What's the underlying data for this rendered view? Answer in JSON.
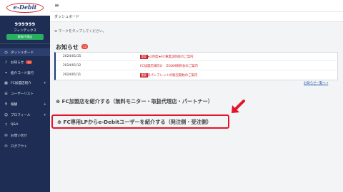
{
  "brand": {
    "logo_text": "e-Debit"
  },
  "user": {
    "id": "999999",
    "company": "フィンテックス",
    "role": "取扱代理店"
  },
  "sidebar": {
    "items": [
      {
        "label": "ダッシュボード",
        "icon": "speedometer-icon"
      },
      {
        "label": "お知らせ",
        "badge": "12",
        "icon": "bell-icon"
      },
      {
        "label": "紹介コード発行",
        "icon": "link-icon"
      },
      {
        "label": "FC加盟店紹介",
        "icon": "store-icon"
      },
      {
        "label": "ユーザーリスト",
        "icon": "list-icon"
      },
      {
        "label": "報酬",
        "icon": "yen-icon"
      },
      {
        "label": "プロフィール",
        "icon": "person-icon"
      },
      {
        "label": "Q&A",
        "icon": "question-icon"
      },
      {
        "label": "お問い合せ",
        "icon": "mail-icon"
      },
      {
        "label": "ログアウト",
        "icon": "logout-icon"
      }
    ]
  },
  "header": {
    "breadcrumb": "ダッシュボード"
  },
  "main": {
    "hint": "マークをタップしてください。",
    "news": {
      "title": "お知らせ",
      "count": "12",
      "items": [
        {
          "date": "2024/01/15",
          "tag": "重要",
          "text": "★2月度★FC事業説明会のご案内"
        },
        {
          "date": "2024/01/12",
          "tag": "",
          "text": "FC加盟店様向け　ZOOM研修会のご案内"
        },
        {
          "date": "2024/01/11",
          "tag": "重要",
          "text": "新パンフレットの販売開始のご案内"
        }
      ],
      "more": "お知らせ一覧へ→"
    },
    "intro_link_1": "FC加盟店を紹介する（無料モニター・取扱代理店・パートナー）",
    "intro_link_2": "FC専用LPからe-Debitユーザーを紹介する（発注側・受注側）"
  },
  "colors": {
    "sidebar_bg": "#1d2d54",
    "accent_red": "#e2152a",
    "badge_green": "#27ae60"
  }
}
